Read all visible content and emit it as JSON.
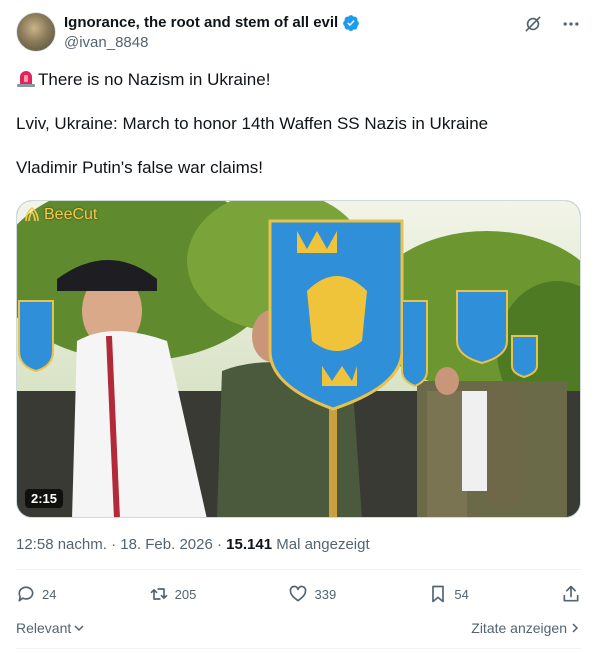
{
  "author": {
    "display_name": "Ignorance, the root and stem of all evil",
    "handle": "@ivan_8848"
  },
  "tweet": {
    "line1": "There is no Nazism in Ukraine!",
    "line2": "Lviv, Ukraine: March to honor 14th Waffen SS Nazis in Ukraine",
    "line3": "Vladimir Putin's false war claims!"
  },
  "media": {
    "watermark": "BeeCut",
    "duration": "2:15"
  },
  "meta": {
    "time": "12:58 nachm.",
    "separator1": "·",
    "date": "18. Feb. 2026",
    "separator2": "·",
    "views": "15.141",
    "views_label": "Mal angezeigt"
  },
  "actions": {
    "replies": "24",
    "reposts": "205",
    "likes": "339",
    "bookmarks": "54"
  },
  "footer": {
    "relevant": "Relevant",
    "quotes": "Zitate anzeigen"
  },
  "colors": {
    "accent": "#1d9bf0",
    "secondary_text": "#536471",
    "primary_text": "#0f1419"
  }
}
